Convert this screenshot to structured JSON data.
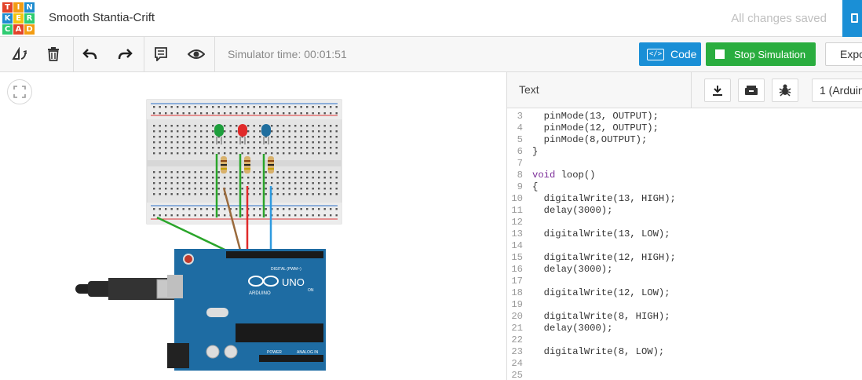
{
  "logo": {
    "letters": [
      "T",
      "I",
      "N",
      "K",
      "E",
      "R",
      "C",
      "A",
      "D"
    ]
  },
  "project": {
    "name": "Smooth Stantia-Crift",
    "save_status": "All changes saved"
  },
  "toolbar": {
    "simulator_time": "Simulator time: 00:01:51",
    "code_label": "Code",
    "code_icon_text": "</>",
    "stop_label": "Stop Simulation",
    "export_label": "Expo"
  },
  "code_panel": {
    "mode": "Text",
    "device_select": "1 (Arduino",
    "lines": [
      {
        "n": "3",
        "text": "  pinMode(13, OUTPUT);"
      },
      {
        "n": "4",
        "text": "  pinMode(12, OUTPUT);"
      },
      {
        "n": "5",
        "text": "  pinMode(8,OUTPUT);"
      },
      {
        "n": "6",
        "text": "}"
      },
      {
        "n": "7",
        "text": ""
      },
      {
        "n": "8",
        "kw": "void",
        "text": " loop()"
      },
      {
        "n": "9",
        "text": "{"
      },
      {
        "n": "10",
        "text": "  digitalWrite(13, HIGH);"
      },
      {
        "n": "11",
        "text": "  delay(3000);"
      },
      {
        "n": "12",
        "text": ""
      },
      {
        "n": "13",
        "text": "  digitalWrite(13, LOW);"
      },
      {
        "n": "14",
        "text": ""
      },
      {
        "n": "15",
        "text": "  digitalWrite(12, HIGH);"
      },
      {
        "n": "16",
        "text": "  delay(3000);"
      },
      {
        "n": "17",
        "text": ""
      },
      {
        "n": "18",
        "text": "  digitalWrite(12, LOW);"
      },
      {
        "n": "19",
        "text": ""
      },
      {
        "n": "20",
        "text": "  digitalWrite(8, HIGH);"
      },
      {
        "n": "21",
        "text": "  delay(3000);"
      },
      {
        "n": "22",
        "text": ""
      },
      {
        "n": "23",
        "text": "  digitalWrite(8, LOW);"
      },
      {
        "n": "24",
        "text": ""
      },
      {
        "n": "25",
        "text": ""
      }
    ]
  },
  "arduino": {
    "brand": "ARDUINO",
    "model": "UNO",
    "on_label": "ON",
    "digital_label": "DIGITAL (PWM~)",
    "power_label": "POWER",
    "analog_label": "ANALOG IN"
  },
  "colors": {
    "accent": "#1a8fd6",
    "stop": "#2aad3f",
    "keyword": "#7b2c98",
    "led_green": "#1e9e3c",
    "led_red": "#e02a2a",
    "led_blue": "#1f6e9e",
    "board": "#1e6ca3"
  },
  "icons": [
    "fit-view-icon",
    "rotate-icon",
    "delete-icon",
    "undo-icon",
    "redo-icon",
    "notes-icon",
    "visibility-icon",
    "code-icon",
    "stop-icon",
    "download-icon",
    "component-library-icon",
    "debugger-bug-icon",
    "panel-icon"
  ]
}
